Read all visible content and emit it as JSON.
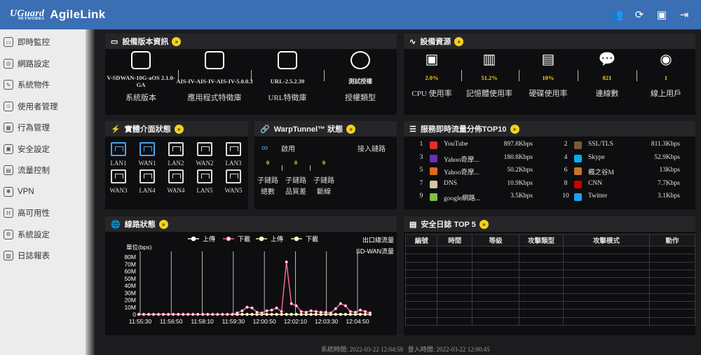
{
  "header": {
    "brand": "UGuard",
    "brand_sub": "NETWORKS",
    "product": "AgileLink"
  },
  "sidebar": {
    "items": [
      {
        "label": "即時監控",
        "icon": "monitor-icon"
      },
      {
        "label": "網路設定",
        "icon": "globe-icon"
      },
      {
        "label": "系統物件",
        "icon": "wrench-icon"
      },
      {
        "label": "使用者管理",
        "icon": "user-card-icon"
      },
      {
        "label": "行為管理",
        "icon": "behavior-icon"
      },
      {
        "label": "安全設定",
        "icon": "security-icon"
      },
      {
        "label": "流量控制",
        "icon": "traffic-icon"
      },
      {
        "label": "VPN",
        "icon": "vpn-icon"
      },
      {
        "label": "高可用性",
        "icon": "ha-icon"
      },
      {
        "label": "系統設定",
        "icon": "settings-icon"
      },
      {
        "label": "日誌報表",
        "icon": "log-icon"
      }
    ]
  },
  "device_info": {
    "title": "設備版本資訊",
    "items": [
      {
        "value": "V-SDWAN-10G-aOS 2.1.0-GA",
        "label": "系統版本"
      },
      {
        "value": "AIS-IV-AIS-IV-AIS-IV-5.0.0.3",
        "label": "應用程式特徵庫"
      },
      {
        "value": "URL-2.5.2.39",
        "label": "URL特徵庫"
      },
      {
        "value": "測試授權",
        "label": "授權類型"
      }
    ]
  },
  "resources": {
    "title": "設備資源",
    "items": [
      {
        "value": "2.0%",
        "label": "CPU 使用率"
      },
      {
        "value": "51.2%",
        "label": "記憶體使用率"
      },
      {
        "value": "10%",
        "label": "硬碟使用率"
      },
      {
        "value": "821",
        "label": "連線數"
      },
      {
        "value": "1",
        "label": "線上用戶"
      }
    ]
  },
  "interfaces": {
    "title": "實體介面狀態",
    "ports": [
      {
        "name": "LAN1",
        "active": true
      },
      {
        "name": "WAN1",
        "active": true
      },
      {
        "name": "LAN2",
        "active": false
      },
      {
        "name": "WAN2",
        "active": false
      },
      {
        "name": "LAN3",
        "active": false
      },
      {
        "name": "WAN3",
        "active": false
      },
      {
        "name": "LAN4",
        "active": false
      },
      {
        "name": "WAN4",
        "active": false
      },
      {
        "name": "LAN5",
        "active": false
      },
      {
        "name": "WAN5",
        "active": false
      }
    ]
  },
  "warp": {
    "title": "WarpTunnel™ 狀態",
    "status": "啟用",
    "link": "接入鏈路",
    "stats": [
      {
        "value": "0",
        "label1": "子鏈路",
        "label2": "總數"
      },
      {
        "value": "0",
        "label1": "子鏈路",
        "label2": "品質差"
      },
      {
        "value": "0",
        "label1": "子鏈路",
        "label2": "斷線"
      }
    ]
  },
  "top10": {
    "title": "服務即時流量分佈TOP10",
    "items": [
      {
        "rank": "1",
        "name": "YouTube",
        "value": "897.8Kbps",
        "color": "#e52d27"
      },
      {
        "rank": "2",
        "name": "SSL/TLS",
        "value": "811.3Kbps",
        "color": "#7a5a3a"
      },
      {
        "rank": "3",
        "name": "Yahoo奇摩...",
        "value": "180.8Kbps",
        "color": "#6b2fb3"
      },
      {
        "rank": "4",
        "name": "Skype",
        "value": "52.9Kbps",
        "color": "#00aff0"
      },
      {
        "rank": "5",
        "name": "Yahoo奇摩...",
        "value": "50.2Kbps",
        "color": "#e06a1c"
      },
      {
        "rank": "6",
        "name": "楓之谷M",
        "value": "13Kbps",
        "color": "#c8742a"
      },
      {
        "rank": "7",
        "name": "DNS",
        "value": "10.9Kbps",
        "color": "#d9c2a0"
      },
      {
        "rank": "8",
        "name": "CNN",
        "value": "7.7Kbps",
        "color": "#cc0000"
      },
      {
        "rank": "9",
        "name": "google網路...",
        "value": "3.5Kbps",
        "color": "#7cc242"
      },
      {
        "rank": "10",
        "name": "Twitter",
        "value": "3.1Kbps",
        "color": "#1da1f2"
      }
    ]
  },
  "line_status": {
    "title": "線路狀態",
    "legend": [
      {
        "label": "上傳",
        "color": "#ffffff"
      },
      {
        "label": "下載",
        "color": "#ff6f9c"
      },
      {
        "label": "上傳",
        "color": "#fff3a0"
      },
      {
        "label": "下載",
        "color": "#fff3a0"
      }
    ],
    "right_labels": [
      "出口總流量",
      "SD-WAN流量"
    ],
    "unit": "單位(bps)"
  },
  "chart_data": {
    "type": "line",
    "ylabel": "單位(bps)",
    "ylim": [
      0,
      80
    ],
    "y_ticks": [
      "0",
      "10M",
      "20M",
      "30M",
      "40M",
      "50M",
      "60M",
      "70M",
      "80M"
    ],
    "x_ticks": [
      "11:55:30",
      "11:56:50",
      "11:58:10",
      "11:59:30",
      "12:00:50",
      "12:02:10",
      "12:03:30",
      "12:04:50"
    ],
    "series": [
      {
        "name": "上傳",
        "values": [
          0,
          0,
          0,
          0,
          0,
          0,
          0,
          0,
          0,
          0,
          0,
          0,
          0,
          0,
          0,
          0,
          0,
          0,
          0,
          0,
          0,
          0,
          0,
          0,
          0,
          0,
          0,
          0,
          0,
          0,
          0,
          0,
          0,
          0,
          0,
          0,
          0,
          0,
          0,
          0,
          0,
          0,
          0,
          0,
          0,
          0,
          0,
          0
        ]
      },
      {
        "name": "下載",
        "values": [
          0,
          0,
          0,
          0,
          0,
          0,
          0,
          0,
          0,
          0,
          0,
          0,
          0,
          0,
          0,
          0,
          0,
          0,
          0,
          0,
          2,
          5,
          10,
          9,
          3,
          2,
          5,
          6,
          9,
          4,
          73,
          15,
          12,
          4,
          3,
          5,
          4,
          3,
          3,
          2,
          8,
          15,
          12,
          4,
          3,
          6,
          4,
          2
        ]
      }
    ]
  },
  "security_log": {
    "title": "安全日誌 TOP 5",
    "columns": [
      "編號",
      "時間",
      "等級",
      "攻擊類型",
      "攻擊模式",
      "動作"
    ]
  },
  "footer": {
    "sys_time_label": "系統時間:",
    "sys_time": "2022-03-22 12:04:58",
    "login_label": "登入時間:",
    "login_time": "2022-03-22 12:00:45"
  }
}
